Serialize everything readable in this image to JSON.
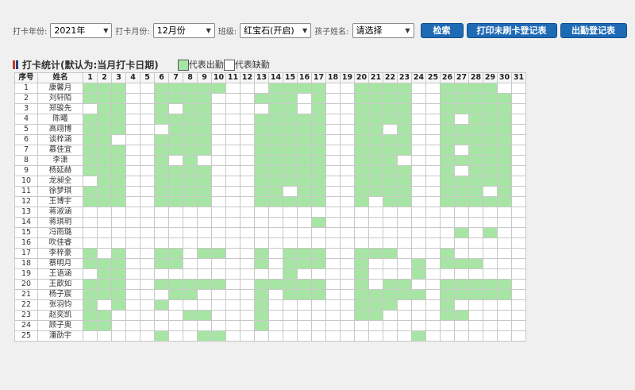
{
  "filters": {
    "year_label": "打卡年份:",
    "year_value": "2021年",
    "month_label": "打卡月份:",
    "month_value": "12月份",
    "class_label": "班级:",
    "class_value": "红宝石(开启)",
    "child_label": "孩子姓名:",
    "child_value": "请选择"
  },
  "buttons": {
    "search": "检索",
    "print_unpunched": "打印未刷卡登记表",
    "attendance": "出勤登记表"
  },
  "section": {
    "title": "打卡统计(默认为:当月打卡日期)",
    "legend_present": "代表出勤",
    "legend_absent": "代表缺勤",
    "marker_colors": [
      "#c0392b",
      "#2c3e7a"
    ]
  },
  "colors": {
    "present": "#a7e5a5",
    "absent": "#ffffff",
    "button": "#1f6ab5"
  },
  "table": {
    "col_no": "序号",
    "col_name": "姓名",
    "days": [
      "1",
      "2",
      "3",
      "4",
      "5",
      "6",
      "7",
      "8",
      "9",
      "10",
      "11",
      "12",
      "13",
      "14",
      "15",
      "16",
      "17",
      "18",
      "19",
      "20",
      "21",
      "22",
      "23",
      "24",
      "25",
      "26",
      "27",
      "28",
      "29",
      "30",
      "31"
    ],
    "rows": [
      {
        "no": "1",
        "name": "康馨月",
        "att": "1110011111000111100111100111100"
      },
      {
        "no": "2",
        "name": "刘轩陌",
        "att": "1110011110001110100111100111110"
      },
      {
        "no": "3",
        "name": "郑骏先",
        "att": "0110010110000110100111100111110"
      },
      {
        "no": "4",
        "name": "陈曦",
        "att": "1110011110001111100111100101110"
      },
      {
        "no": "5",
        "name": "高翊博",
        "att": "1110001110001111100110100111110"
      },
      {
        "no": "6",
        "name": "谈梓涵",
        "att": "1100011110001111100111100111110"
      },
      {
        "no": "7",
        "name": "慕佳宜",
        "att": "1110011110001111100111100101110"
      },
      {
        "no": "8",
        "name": "李潇",
        "att": "1110010100001111100111000111110"
      },
      {
        "no": "9",
        "name": "杨延赫",
        "att": "1110011110001111100111100101110"
      },
      {
        "no": "10",
        "name": "龙昶全",
        "att": "0110011110001111100111100111110"
      },
      {
        "no": "11",
        "name": "徐梦琪",
        "att": "1110011110001101100111100111010"
      },
      {
        "no": "12",
        "name": "王博宇",
        "att": "1110011110001111100101100111110"
      },
      {
        "no": "13",
        "name": "蒋淑涵",
        "att": "0000000000000000000000000000000"
      },
      {
        "no": "14",
        "name": "蒋琪玥",
        "att": "0000000000000000100000000000000"
      },
      {
        "no": "15",
        "name": "冯雨璐",
        "att": "0000000000000000000000000010100"
      },
      {
        "no": "16",
        "name": "吹佳睿",
        "att": "0000000000000000000000000000000"
      },
      {
        "no": "17",
        "name": "李梓豪",
        "att": "1010011011001011100111000100000"
      },
      {
        "no": "18",
        "name": "蔡明月",
        "att": "1110011000001011100100010111000"
      },
      {
        "no": "19",
        "name": "王语涵",
        "att": "0110000000000010000100010000000"
      },
      {
        "no": "20",
        "name": "王歆如",
        "att": "1110011111001111100101100111110"
      },
      {
        "no": "21",
        "name": "杨子宸",
        "att": "1110001100001011100111110111110"
      },
      {
        "no": "22",
        "name": "张羽钧",
        "att": "1010010000001000000111000100000"
      },
      {
        "no": "23",
        "name": "赵奕凯",
        "att": "1100000110001000000110000110000"
      },
      {
        "no": "24",
        "name": "顾子奥",
        "att": "1100000000001000000000000000000"
      },
      {
        "no": "25",
        "name": "潘劭宇",
        "att": "0000010011000000000000010000000"
      }
    ]
  }
}
